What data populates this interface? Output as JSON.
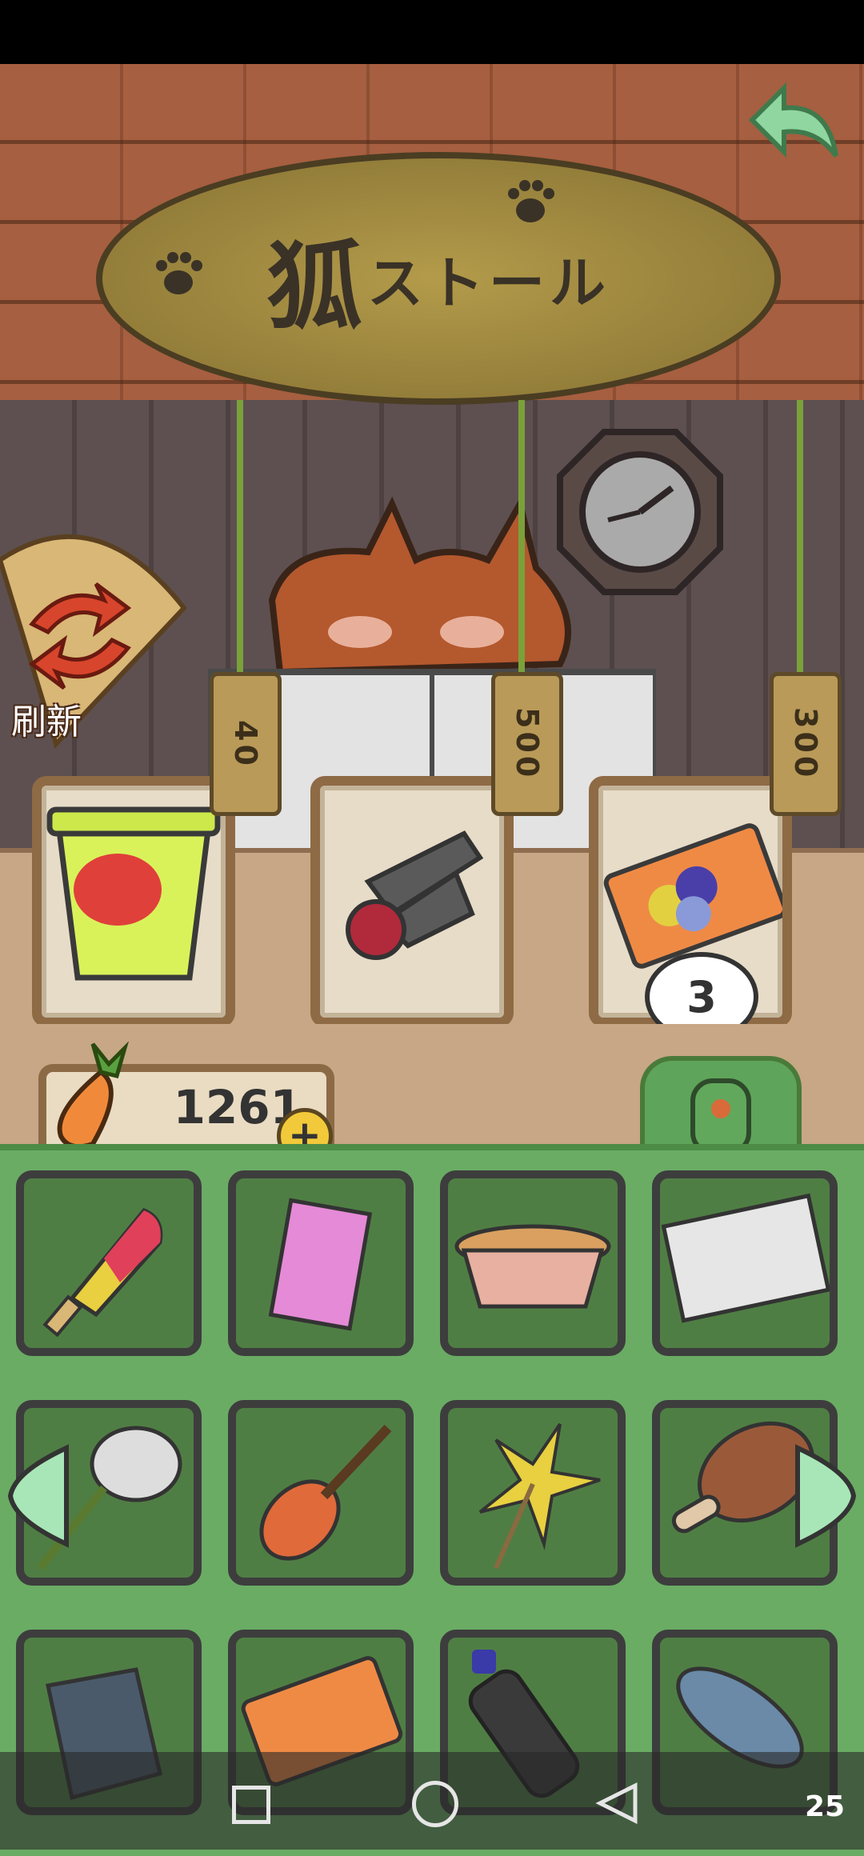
{
  "shop": {
    "sign_kanji": "狐",
    "sign_kana": "ストール",
    "refresh_label": "刷新",
    "items": [
      {
        "name": "cup-noodles",
        "price": "40"
      },
      {
        "name": "bowling-pins",
        "price": "500"
      },
      {
        "name": "collection-ticket",
        "price": "300",
        "stock": "3"
      }
    ]
  },
  "wallet": {
    "carrots": "1261"
  },
  "inventory": {
    "items": [
      "popsicle",
      "pocky-box",
      "cup-ramen",
      "snow-mountain-ticket",
      "butterfly-net",
      "ukulele",
      "pinwheel",
      "drumstick",
      "map-scroll",
      "collection-ticket",
      "water-bottle",
      "fish"
    ]
  },
  "navbar": {
    "page_number": "25"
  },
  "colors": {
    "inventory_bg": "#6aac64",
    "slot_bg": "#4f7e44",
    "roof": "#a65f40",
    "counter": "#c7a785"
  }
}
